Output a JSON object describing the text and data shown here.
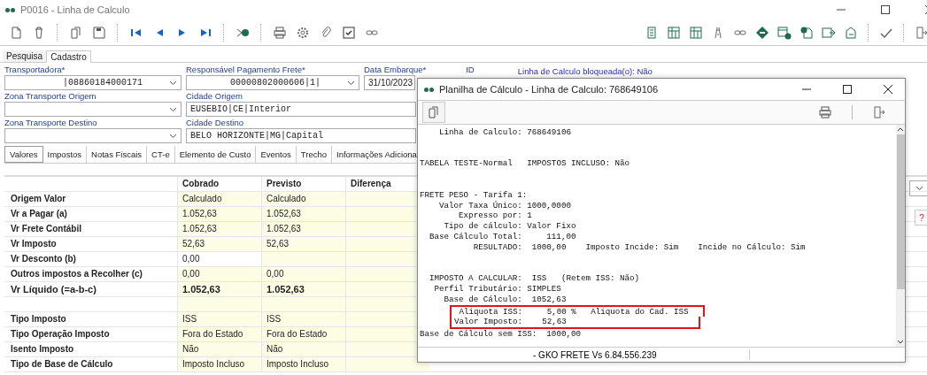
{
  "window": {
    "title": "P0016 - Linha de Calculo"
  },
  "view_tabs": [
    {
      "label": "Pesquisa",
      "selected": false
    },
    {
      "label": "Cadastro",
      "selected": true
    }
  ],
  "form": {
    "rows": [
      [
        {
          "kind": "select",
          "label": "Transportadora*",
          "value": "|08860184000171"
        },
        {
          "kind": "select",
          "label": "Responsável Pagamento Frete*",
          "value": "00000802000606|1|"
        },
        {
          "kind": "date",
          "label": "Data Embarque*",
          "value": "31/10/2023"
        },
        {
          "kind": "label",
          "label": "ID"
        }
      ],
      [
        {
          "kind": "select",
          "label": "Zona Transporte Origem"
        },
        {
          "kind": "input",
          "label": "Cidade Origem",
          "value": "EUSEBIO|CE|Interior"
        }
      ],
      [
        {
          "kind": "select",
          "label": "Zona Transporte Destino"
        },
        {
          "kind": "input",
          "label": "Cidade Destino",
          "value": "BELO HORIZONTE|MG|Capital"
        }
      ]
    ],
    "status": "Linha de Calculo bloqueada(o): Não"
  },
  "detail_tabs": [
    {
      "label": "Valores",
      "selected": true
    },
    {
      "label": "Impostos",
      "selected": false
    },
    {
      "label": "Notas Fiscais",
      "selected": false
    },
    {
      "label": "CT-e",
      "selected": false
    },
    {
      "label": "Elemento de Custo",
      "selected": false
    },
    {
      "label": "Eventos",
      "selected": false
    },
    {
      "label": "Trecho",
      "selected": false
    },
    {
      "label": "Informações Adiciona",
      "selected": false
    }
  ],
  "grid": {
    "columns": [
      "Cobrado",
      "Previsto",
      "Diferença"
    ],
    "rows": [
      {
        "kind": "data",
        "label": "Origem Valor",
        "emphasis": false,
        "cells": [
          {
            "text": "Calculado",
            "editable": false
          },
          {
            "text": "Calculado",
            "editable": false
          }
        ]
      },
      {
        "kind": "data",
        "label": "Vr a Pagar (a)",
        "emphasis": false,
        "cells": [
          {
            "text": "1.052,63",
            "editable": false
          },
          {
            "text": "1.052,63",
            "editable": false
          }
        ]
      },
      {
        "kind": "data",
        "label": "Vr Frete Contábil",
        "emphasis": false,
        "cells": [
          {
            "text": "1.052,63",
            "editable": false
          },
          {
            "text": "1.052,63",
            "editable": false
          }
        ]
      },
      {
        "kind": "data",
        "label": "Vr Imposto",
        "emphasis": false,
        "cells": [
          {
            "text": "52,63",
            "editable": false
          },
          {
            "text": "52,63",
            "editable": false
          }
        ]
      },
      {
        "kind": "data",
        "label": "Vr Desconto (b)",
        "emphasis": false,
        "cells": [
          {
            "text": "0,00",
            "editable": true
          },
          {
            "editable": false
          }
        ]
      },
      {
        "kind": "data",
        "label": "Outros impostos a Recolher (c)",
        "emphasis": false,
        "cells": [
          {
            "text": "0,00",
            "editable": false
          },
          {
            "text": "0,00",
            "editable": false
          }
        ]
      },
      {
        "kind": "data",
        "label": "Vr Líquido (=a-b-c)",
        "emphasis": true,
        "cells": [
          {
            "text": "1.052,63",
            "editable": false
          },
          {
            "text": "1.052,63",
            "editable": false
          }
        ]
      },
      {
        "kind": "spacer"
      },
      {
        "kind": "data",
        "label": "Tipo Imposto",
        "emphasis": false,
        "cells": [
          {
            "text": "ISS",
            "editable": false
          },
          {
            "text": "ISS",
            "editable": false
          }
        ]
      },
      {
        "kind": "data",
        "label": "Tipo Operação Imposto",
        "emphasis": false,
        "cells": [
          {
            "text": "Fora do Estado",
            "editable": false
          },
          {
            "text": "Fora do Estado",
            "editable": false
          }
        ]
      },
      {
        "kind": "data",
        "label": "Isento Imposto",
        "emphasis": false,
        "cells": [
          {
            "text": "Não",
            "editable": false
          },
          {
            "text": "Não",
            "editable": false
          }
        ]
      },
      {
        "kind": "data",
        "label": "Tipo de Base de Cálculo",
        "emphasis": false,
        "cells": [
          {
            "text": "Imposto Incluso",
            "editable": false
          },
          {
            "text": "Imposto Incluso",
            "editable": false
          }
        ]
      }
    ]
  },
  "help_button": {
    "label": "?"
  },
  "dialog": {
    "title": "Planilha de Cálculo - Linha de Calculo: 768649106",
    "blocks": [
      [
        {
          "text": "    Linha de Calculo: 768649106",
          "boxed": false
        }
      ],
      [
        {
          "text": "TABELA TESTE-Normal   IMPOSTOS INCLUSO: Não",
          "boxed": false
        }
      ],
      [
        {
          "text": "FRETE PESO - Tarifa 1:",
          "boxed": false
        },
        {
          "text": "    Valor Taxa Único: 1000,0000",
          "boxed": false
        },
        {
          "text": "        Expresso por: 1",
          "boxed": false
        },
        {
          "text": "     Tipo de cálculo: Valor Fixo",
          "boxed": false
        },
        {
          "text": "  Base Cálculo Total:     111,00",
          "boxed": false
        },
        {
          "text": "           RESULTADO:  1000,00    Imposto Incide: Sim    Incide no Cálculo: Sim",
          "boxed": false
        }
      ],
      [
        {
          "text": "  IMPOSTO A CALCULAR:  ISS   (Retem ISS: Não)",
          "boxed": false
        },
        {
          "text": "   Perfil Tributário: SIMPLES",
          "boxed": false
        },
        {
          "text": "     Base de Cálculo:  1052,63",
          "boxed": false
        },
        {
          "text": "        Aliquota ISS:     5,00 %   Aliquota do Cad. ISS",
          "boxed": true
        },
        {
          "text": "       Valor Imposto:    52,63",
          "boxed": true
        },
        {
          "text": "Base de Cálculo sem ISS:  1000,00",
          "boxed": false
        }
      ]
    ],
    "status": "- GKO FRETE Vs 6.84.556.239"
  }
}
